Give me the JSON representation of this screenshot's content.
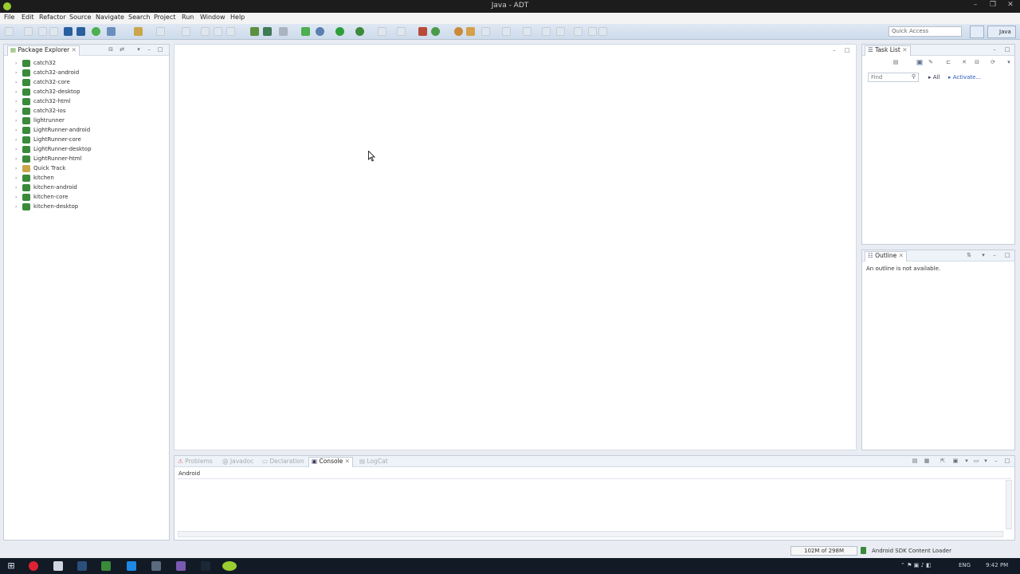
{
  "window": {
    "title": "Java - ADT"
  },
  "menu": [
    "File",
    "Edit",
    "Refactor",
    "Source",
    "Navigate",
    "Search",
    "Project",
    "Run",
    "Window",
    "Help"
  ],
  "toolbar": {
    "quick_access_placeholder": "Quick Access",
    "perspective_label": "Java"
  },
  "package_explorer": {
    "title": "Package Explorer",
    "projects": [
      "catch32",
      "catch32-android",
      "catch32-core",
      "catch32-desktop",
      "catch32-html",
      "catch32-ios",
      "lightrunner",
      "LightRunner-android",
      "LightRunner-core",
      "LightRunner-desktop",
      "LightRunner-html",
      "Quick Track",
      "kitchen",
      "kitchen-android",
      "kitchen-core",
      "kitchen-desktop"
    ]
  },
  "task_list": {
    "title": "Task List",
    "find_placeholder": "Find",
    "all_label": "All",
    "activate_label": "Activate..."
  },
  "outline": {
    "title": "Outline",
    "message": "An outline is not available."
  },
  "bottom_panel": {
    "tabs": [
      "Problems",
      "Javadoc",
      "Declaration",
      "Console",
      "LogCat"
    ],
    "active_tab": "Console",
    "console_label": "Android"
  },
  "status_bar": {
    "heap": "102M of 298M",
    "sdk_label": "Android SDK Content Loader"
  },
  "taskbar": {
    "language": "ENG",
    "time": "9:42 PM"
  }
}
